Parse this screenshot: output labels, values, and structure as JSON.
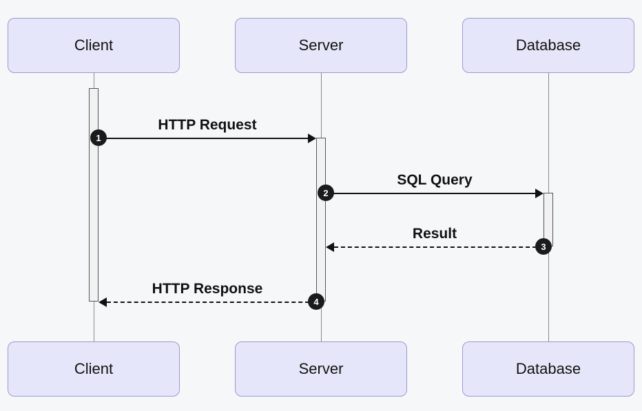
{
  "diagram": {
    "type": "sequence",
    "participants": [
      {
        "id": "client",
        "label": "Client"
      },
      {
        "id": "server",
        "label": "Server"
      },
      {
        "id": "database",
        "label": "Database"
      }
    ],
    "messages": [
      {
        "step": "1",
        "from": "client",
        "to": "server",
        "label": "HTTP Request",
        "style": "solid"
      },
      {
        "step": "2",
        "from": "server",
        "to": "database",
        "label": "SQL Query",
        "style": "solid"
      },
      {
        "step": "3",
        "from": "database",
        "to": "server",
        "label": "Result",
        "style": "dashed"
      },
      {
        "step": "4",
        "from": "server",
        "to": "client",
        "label": "HTTP Response",
        "style": "dashed"
      }
    ]
  }
}
